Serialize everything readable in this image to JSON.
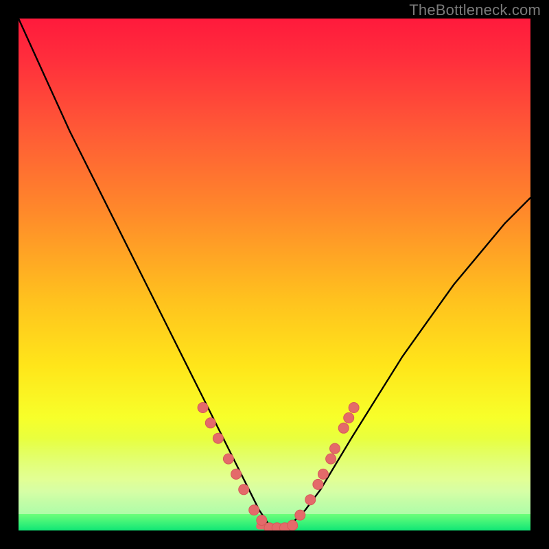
{
  "watermark": "TheBottleneck.com",
  "colors": {
    "frame": "#000000",
    "watermark": "#7b7b7b",
    "curve": "#000000",
    "marker": "#e46a6a",
    "marker_stroke": "#d65a5a",
    "gradient_top": "#ff1a3c",
    "gradient_bottom": "#29f58a"
  },
  "chart_data": {
    "type": "line",
    "title": "",
    "xlabel": "",
    "ylabel": "",
    "xlim": [
      0,
      100
    ],
    "ylim": [
      0,
      100
    ],
    "grid": false,
    "legend": false,
    "series": [
      {
        "name": "bottleneck-curve",
        "x": [
          0,
          5,
          10,
          15,
          20,
          25,
          30,
          33,
          36,
          39,
          42,
          45,
          47,
          49,
          51,
          53,
          56,
          59,
          62,
          65,
          70,
          75,
          80,
          85,
          90,
          95,
          100
        ],
        "y": [
          100,
          89,
          78,
          68,
          58,
          48,
          38,
          32,
          26,
          20,
          14,
          8,
          4,
          1,
          0,
          1,
          4,
          8,
          13,
          18,
          26,
          34,
          41,
          48,
          54,
          60,
          65
        ]
      }
    ],
    "markers": {
      "name": "highlighted-points",
      "color": "#e46a6a",
      "points": [
        {
          "x": 36.0,
          "y": 24
        },
        {
          "x": 37.5,
          "y": 21
        },
        {
          "x": 39.0,
          "y": 18
        },
        {
          "x": 41.0,
          "y": 14
        },
        {
          "x": 42.5,
          "y": 11
        },
        {
          "x": 44.0,
          "y": 8
        },
        {
          "x": 46.0,
          "y": 4
        },
        {
          "x": 47.5,
          "y": 2
        },
        {
          "x": 49.0,
          "y": 0.5
        },
        {
          "x": 50.5,
          "y": 0.5
        },
        {
          "x": 52.0,
          "y": 0.5
        },
        {
          "x": 53.5,
          "y": 1
        },
        {
          "x": 55.0,
          "y": 3
        },
        {
          "x": 57.0,
          "y": 6
        },
        {
          "x": 58.5,
          "y": 9
        },
        {
          "x": 59.5,
          "y": 11
        },
        {
          "x": 61.0,
          "y": 14
        },
        {
          "x": 61.8,
          "y": 16
        },
        {
          "x": 63.5,
          "y": 20
        },
        {
          "x": 64.5,
          "y": 22
        },
        {
          "x": 65.5,
          "y": 24
        }
      ]
    }
  }
}
